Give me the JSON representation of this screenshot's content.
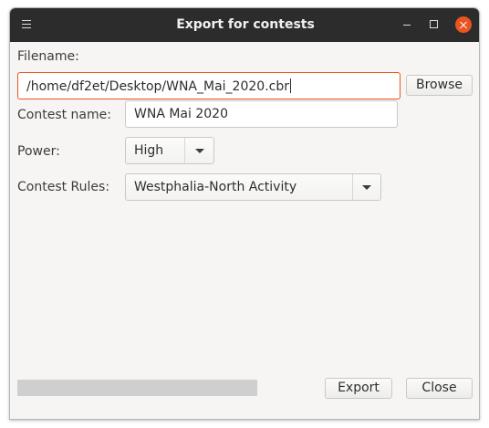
{
  "window": {
    "title": "Export for contests"
  },
  "titlebar_icons": {
    "menu": "hamburger-menu-icon",
    "minimize": "minimize-icon",
    "maximize": "maximize-icon",
    "close": "close-icon"
  },
  "colors": {
    "titlebar_bg": "#2c2c2c",
    "accent": "#e95420",
    "window_bg": "#f6f5f4",
    "progress_track": "#cfcfcf"
  },
  "form": {
    "filename_label": "Filename:",
    "filename_value": "/home/df2et/Desktop/WNA_Mai_2020.cbr",
    "browse_label": "Browse",
    "contest_name_label": "Contest name:",
    "contest_name_value": "WNA Mai 2020",
    "power_label": "Power:",
    "power_selected": "High",
    "contest_rules_label": "Contest Rules:",
    "contest_rules_selected": "Westphalia-North Activity"
  },
  "progress": {
    "fraction": 0
  },
  "footer": {
    "export_label": "Export",
    "close_label": "Close"
  }
}
